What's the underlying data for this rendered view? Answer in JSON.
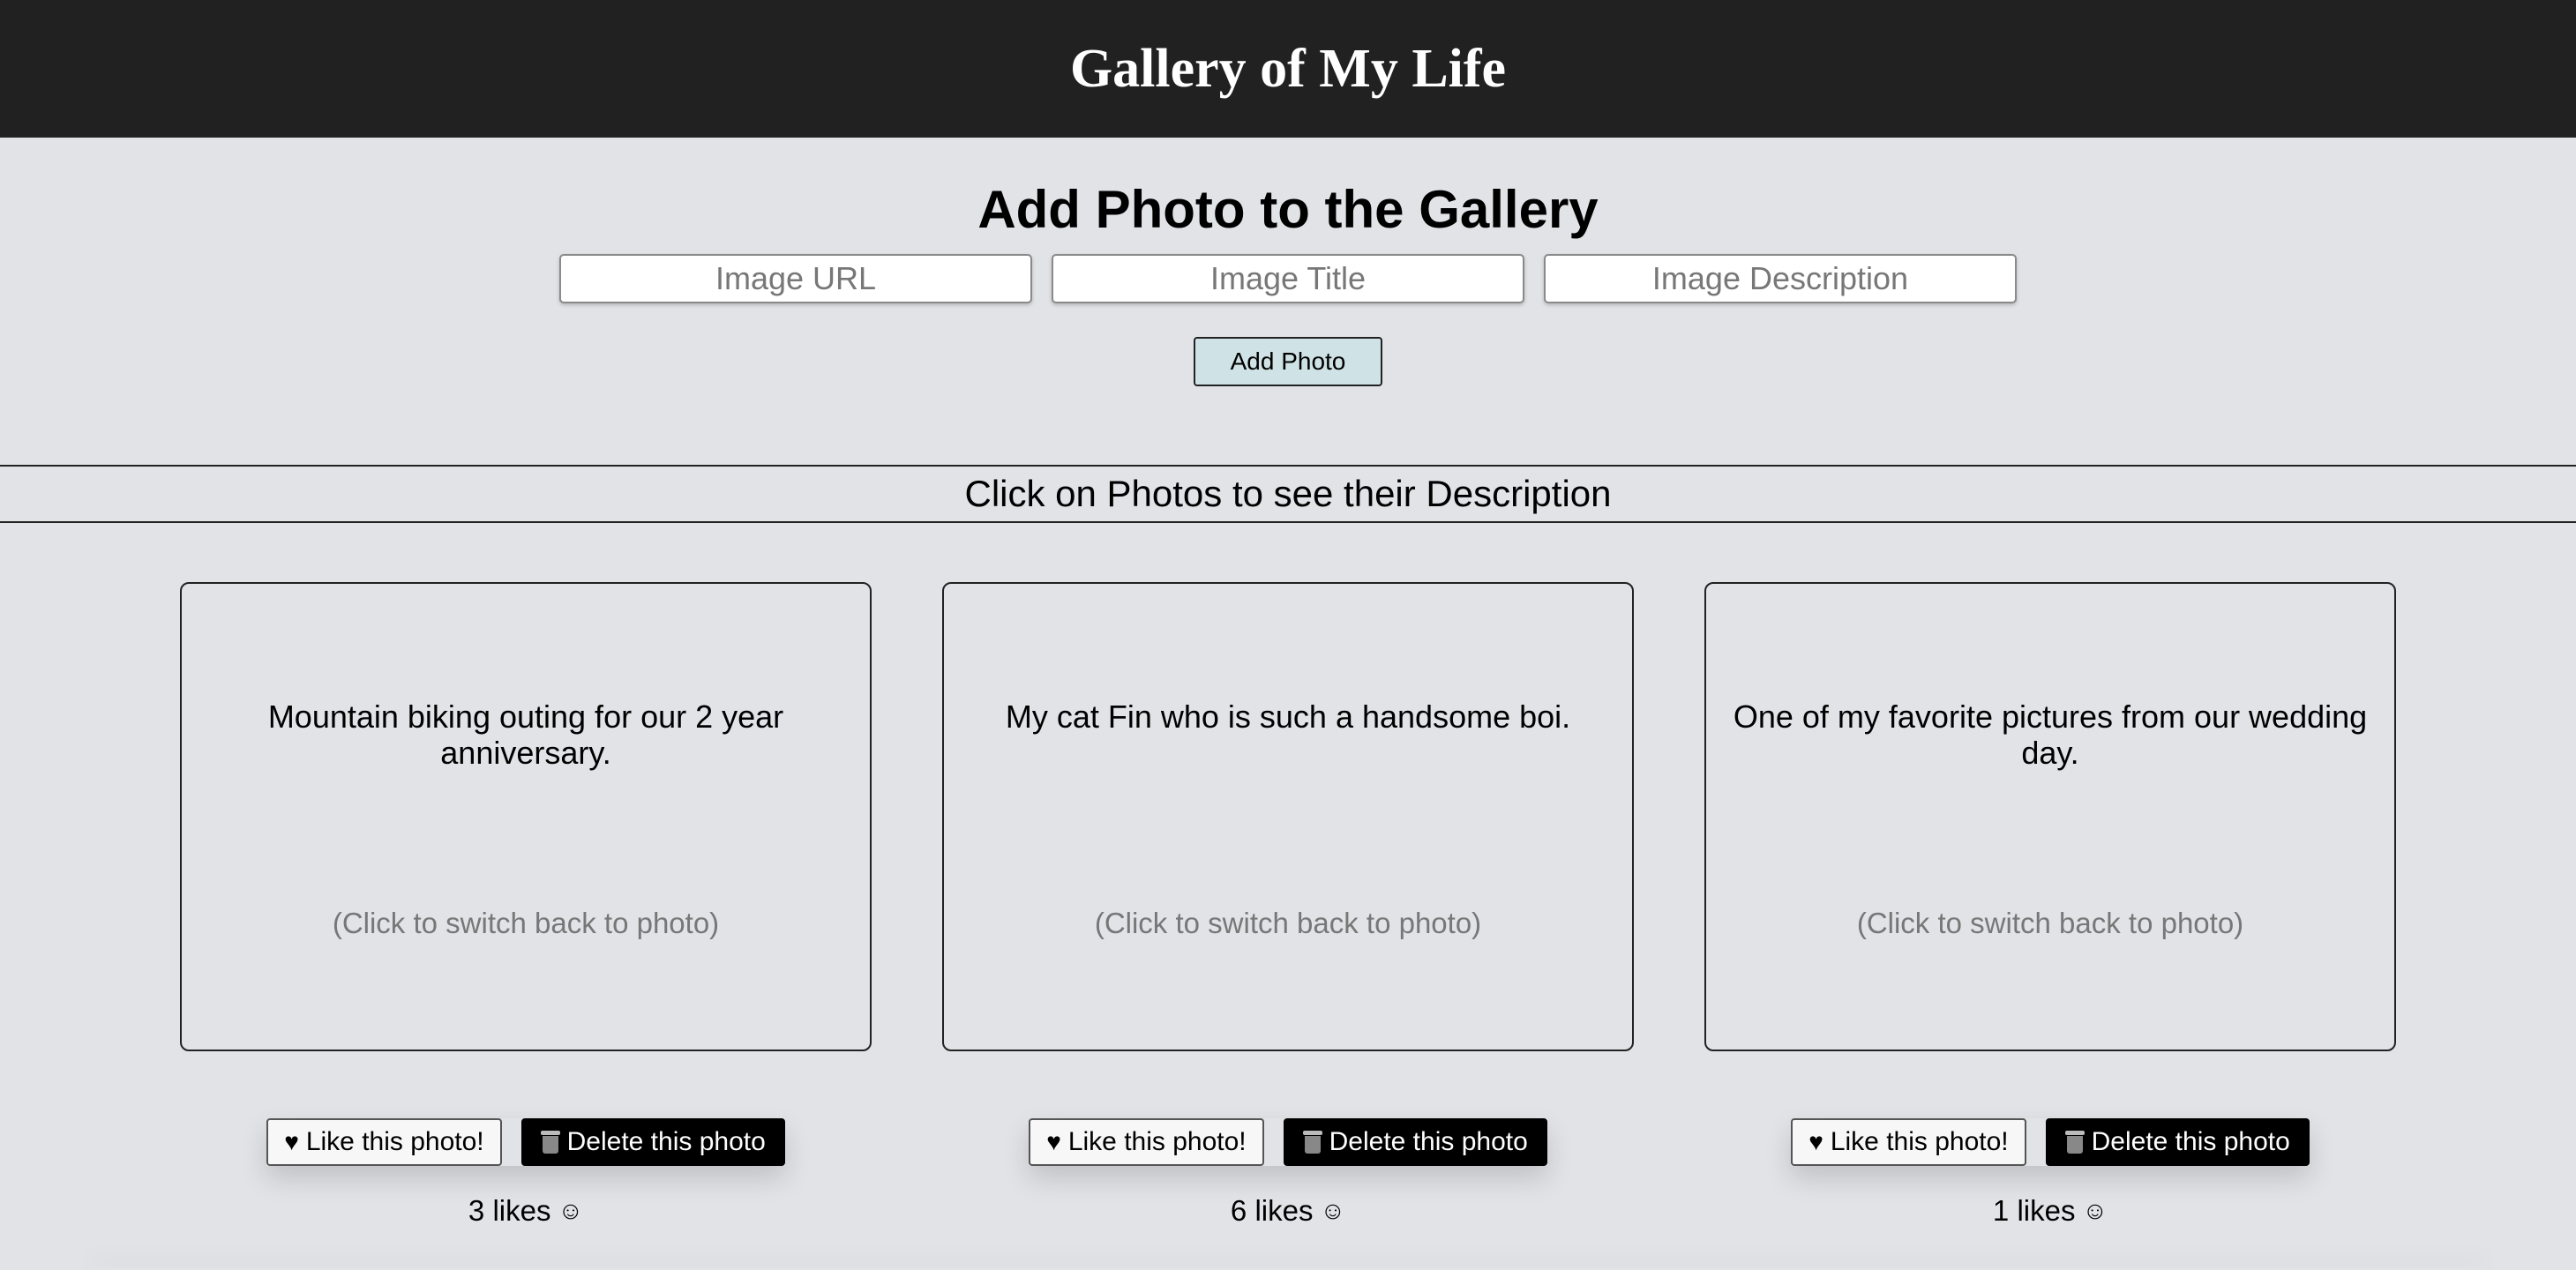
{
  "header": {
    "title": "Gallery of My Life"
  },
  "add_form": {
    "heading": "Add Photo to the Gallery",
    "url_placeholder": "Image URL",
    "title_placeholder": "Image Title",
    "description_placeholder": "Image Description",
    "add_button_label": "Add Photo"
  },
  "instructions": "Click on Photos to see their Description",
  "colors": {
    "header_bg": "#212121",
    "page_bg": "#e2e3e7",
    "add_button_bg": "#cfe3e6",
    "delete_button_bg": "#000000"
  },
  "photos": [
    {
      "description": "Mountain biking outing for our 2 year anniversary.",
      "hint": "(Click to switch back to photo)",
      "like_label": "Like this photo!",
      "delete_label": "Delete this photo",
      "likes_text": "3 likes",
      "like_icon": "heart-icon",
      "delete_icon": "trash-icon"
    },
    {
      "description": "My cat Fin who is such a handsome boi.",
      "hint": "(Click to switch back to photo)",
      "like_label": "Like this photo!",
      "delete_label": "Delete this photo",
      "likes_text": "6 likes",
      "like_icon": "heart-icon",
      "delete_icon": "trash-icon"
    },
    {
      "description": "One of my favorite pictures from our wedding day.",
      "hint": "(Click to switch back to photo)",
      "like_label": "Like this photo!",
      "delete_label": "Delete this photo",
      "likes_text": "1 likes",
      "like_icon": "heart-icon",
      "delete_icon": "trash-icon"
    }
  ]
}
